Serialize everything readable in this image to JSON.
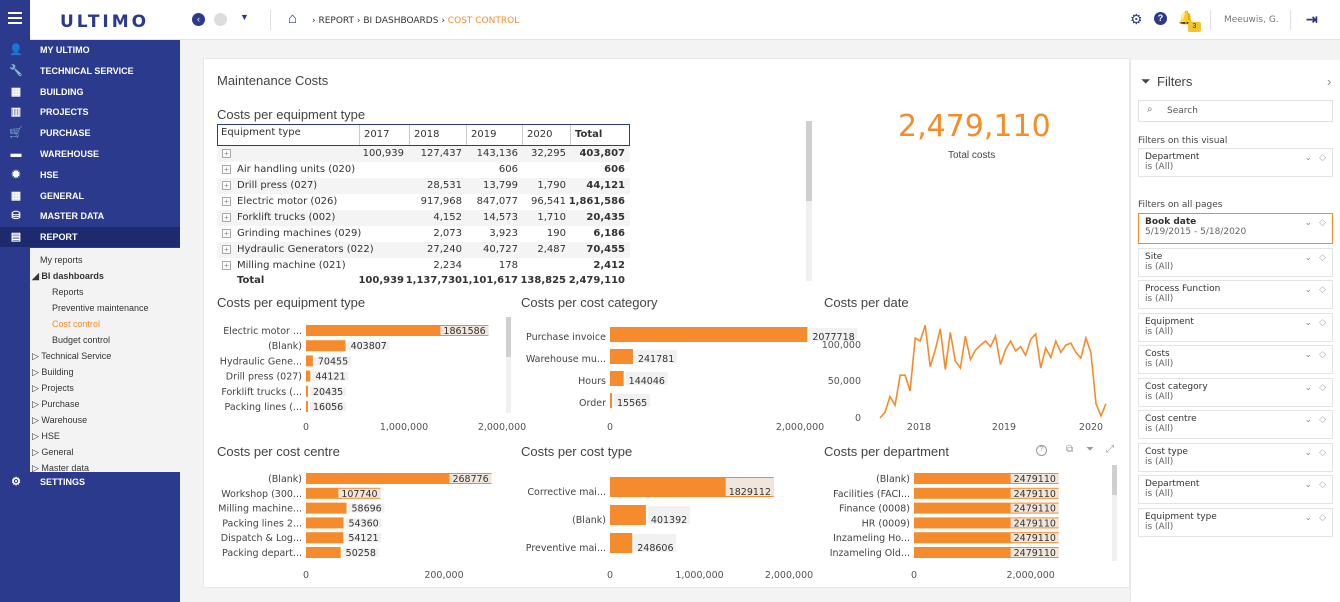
{
  "app": {
    "logo": "ULTIMO",
    "user": "Meeuwis, G.",
    "notif_count": "3"
  },
  "breadcrumb": {
    "a": "REPORT",
    "b": "BI DASHBOARDS",
    "c": "COST CONTROL"
  },
  "menu": {
    "items": [
      "MY ULTIMO",
      "TECHNICAL SERVICE",
      "BUILDING",
      "PROJECTS",
      "PURCHASE",
      "WAREHOUSE",
      "HSE",
      "GENERAL",
      "MASTER DATA",
      "REPORT"
    ],
    "sub": [
      "My reports",
      "BI dashboards",
      "Reports",
      "Preventive maintenance",
      "Cost control",
      "Budget control",
      "Technical Service",
      "Building",
      "Projects",
      "Purchase",
      "Warehouse",
      "HSE",
      "General",
      "Master data"
    ],
    "settings": "SETTINGS"
  },
  "page": {
    "title": "Maintenance Costs",
    "matrix_title": "Costs per equipment type",
    "total_value": "2,479,110",
    "total_label": "Total costs"
  },
  "matrix": {
    "headers": [
      "Equipment type",
      "2017",
      "2018",
      "2019",
      "2020",
      "Total"
    ],
    "rows": [
      [
        "",
        "100,939",
        "127,437",
        "143,136",
        "32,295",
        "403,807"
      ],
      [
        "Air handling units (020)",
        "",
        "",
        "606",
        "",
        "606"
      ],
      [
        "Drill press (027)",
        "",
        "28,531",
        "13,799",
        "1,790",
        "44,121"
      ],
      [
        "Electric motor (026)",
        "",
        "917,968",
        "847,077",
        "96,541",
        "1,861,586"
      ],
      [
        "Forklift trucks (002)",
        "",
        "4,152",
        "14,573",
        "1,710",
        "20,435"
      ],
      [
        "Grinding machines (029)",
        "",
        "2,073",
        "3,923",
        "190",
        "6,186"
      ],
      [
        "Hydraulic Generators (022)",
        "",
        "27,240",
        "40,727",
        "2,487",
        "70,455"
      ],
      [
        "Milling machine (021)",
        "",
        "2,234",
        "178",
        "",
        "2,412"
      ]
    ],
    "total": [
      "Total",
      "100,939",
      "1,137,730",
      "1,101,617",
      "138,825",
      "2,479,110"
    ]
  },
  "charts_titles": [
    "Costs per equipment type",
    "Costs per cost category",
    "Costs per date",
    "Costs per cost centre",
    "Costs per cost type",
    "Costs per department"
  ],
  "chart_data": [
    {
      "type": "bar",
      "title": "Costs per equipment type",
      "categories": [
        "Electric motor ...",
        "(Blank)",
        "Hydraulic Gene...",
        "Drill press (027)",
        "Forklift trucks (...",
        "Packing lines (..."
      ],
      "values": [
        1861586,
        403807,
        70455,
        44121,
        20435,
        16056
      ],
      "xlim": [
        0,
        2000000
      ],
      "xticks": [
        "0",
        "1,000,000",
        "2,000,000"
      ]
    },
    {
      "type": "bar",
      "title": "Costs per cost category",
      "categories": [
        "Purchase invoice",
        "Warehouse mu...",
        "Hours",
        "Order"
      ],
      "values": [
        2077718,
        241781,
        144046,
        15565
      ],
      "xlim": [
        0,
        2000000
      ],
      "xticks": [
        "0",
        "2,000,000"
      ]
    },
    {
      "type": "line",
      "title": "Costs per date",
      "x_ticks": [
        "2018",
        "2019",
        "2020"
      ],
      "yticks": [
        "0",
        "50,000",
        "100,000"
      ],
      "ylim": [
        0,
        150000
      ],
      "values": [
        0,
        8000,
        30000,
        18000,
        60000,
        60000,
        38000,
        112000,
        108000,
        130000,
        72000,
        95000,
        125000,
        68000,
        120000,
        80000,
        70000,
        115000,
        82000,
        95000,
        102000,
        108000,
        100000,
        115000,
        75000,
        96000,
        108000,
        94000,
        100000,
        88000,
        110000,
        118000,
        70000,
        98000,
        85000,
        108000,
        92000,
        102000,
        105000,
        92000,
        84000,
        112000,
        92000,
        20000,
        3000,
        20000
      ]
    },
    {
      "type": "bar",
      "title": "Costs per cost centre",
      "categories": [
        "(Blank)",
        "Workshop (300...",
        "Milling machine...",
        "Packing lines 2...",
        "Dispatch & Log...",
        "Packing depart..."
      ],
      "values": [
        268776,
        107740,
        58696,
        54360,
        54121,
        50258
      ],
      "xlim": [
        0,
        300000
      ],
      "xticks": [
        "0",
        "200,000"
      ]
    },
    {
      "type": "bar",
      "title": "Costs per cost type",
      "categories": [
        "Corrective mai...",
        "(Blank)",
        "Preventive mai..."
      ],
      "values": [
        1829112,
        401392,
        248606
      ],
      "xlim": [
        0,
        2000000
      ],
      "xticks": [
        "0",
        "1,000,000",
        "2,000,000"
      ]
    },
    {
      "type": "bar",
      "title": "Costs per department",
      "categories": [
        "(Blank)",
        "Facilities (FACI...",
        "Finance (0008)",
        "HR (0009)",
        "Inzameling Ho...",
        "Inzameling Old..."
      ],
      "values": [
        2479110,
        2479110,
        2479110,
        2479110,
        2479110,
        2479110
      ],
      "xlim": [
        0,
        3000000
      ],
      "xticks": [
        "0",
        "2,000,000"
      ]
    }
  ],
  "filters": {
    "title": "Filters",
    "search": "Search",
    "on_visual": "Filters on this visual",
    "on_all": "Filters on all pages",
    "visual": [
      {
        "name": "Department",
        "value": "is (All)"
      }
    ],
    "all": [
      {
        "name": "Book date",
        "value": "5/19/2015 - 5/18/2020"
      },
      {
        "name": "Site",
        "value": "is (All)"
      },
      {
        "name": "Process Function",
        "value": "is (All)"
      },
      {
        "name": "Equipment",
        "value": "is (All)"
      },
      {
        "name": "Costs",
        "value": "is (All)"
      },
      {
        "name": "Cost category",
        "value": "is (All)"
      },
      {
        "name": "Cost centre",
        "value": "is (All)"
      },
      {
        "name": "Cost type",
        "value": "is (All)"
      },
      {
        "name": "Department",
        "value": "is (All)"
      },
      {
        "name": "Equipment type",
        "value": "is (All)"
      }
    ]
  },
  "colors": {
    "accent": "#f48c2a",
    "nav": "#2b3a8c",
    "bar": "#f68b2d"
  }
}
